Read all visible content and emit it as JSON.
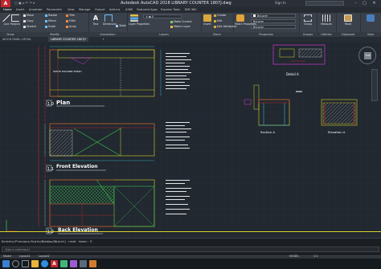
{
  "titlebar": {
    "title": "Autodesk AutoCAD 2018  LIBRARY COUNTER 1807J.dwg",
    "signin": "Sign In",
    "search_placeholder": "Type a keyword or phrase"
  },
  "ribbon_tabs": [
    "Home",
    "Insert",
    "Annotate",
    "Parametric",
    "View",
    "Manage",
    "Output",
    "Add-ins",
    "A360",
    "Featured Apps",
    "Express Tools",
    "BIM 360"
  ],
  "ribbon": {
    "draw": {
      "title": "Draw",
      "line": "Line",
      "polyline": "Polyline",
      "circle": "Circle",
      "arc": "Arc"
    },
    "modify": {
      "title": "Modify",
      "move": "Move",
      "rotate": "Rotate",
      "trim": "Trim",
      "copy": "Copy",
      "mirror": "Mirror",
      "fillet": "Fillet",
      "stretch": "Stretch",
      "scale": "Scale",
      "array": "Array"
    },
    "annotation": {
      "title": "Annotation",
      "text": "Text",
      "dimension": "Dimension",
      "table": "Table"
    },
    "layers": {
      "title": "Layers",
      "layer_properties": "Layer Properties",
      "make_current": "Make Current",
      "match_layer": "Match Layer"
    },
    "block": {
      "title": "Block",
      "insert": "Insert",
      "create": "Create",
      "edit": "Edit",
      "edit_attributes": "Edit Attributes"
    },
    "properties": {
      "title": "Properties",
      "match": "Match Properties",
      "color": "ByLayer",
      "lineweight": "ByLayer",
      "linetype": "ByLayer"
    },
    "groups": {
      "title": "Groups",
      "group": "Group"
    },
    "utilities": {
      "title": "Utilities",
      "measure": "Measure"
    },
    "clipboard": {
      "title": "Clipboard",
      "paste": "Paste"
    },
    "view": {
      "title": "View"
    }
  },
  "doc_tabs": [
    "WOOD PANEL DETAIL",
    "LIBRARY COUNTER 1807J*"
  ],
  "drawing": {
    "plan_title": "Plan",
    "plan_num": "1.0",
    "front_title": "Front Elevation",
    "front_num": "1.1",
    "back_title": "Back Elevation",
    "back_num": "1.2",
    "detail_title": "Detail A",
    "section_title": "Section A",
    "elevation_a_title": "Elevation A",
    "panel_label": "WHITE POLYMER FINISH"
  },
  "command": {
    "history": "Extents/Previous/Scale/Window/Object] <real time>: E",
    "placeholder": "Type a command"
  },
  "status": {
    "model": "MODEL",
    "scale": "1:1",
    "layout_tabs": [
      "Model",
      "Layout1",
      "Layout2"
    ]
  },
  "colors": {
    "accent_red": "#c0262c",
    "canvas": "#212830",
    "yellow_line": "#d9d32a",
    "magenta": "#d23ad0",
    "cyan": "#3fc6d6",
    "green": "#36c23a"
  }
}
